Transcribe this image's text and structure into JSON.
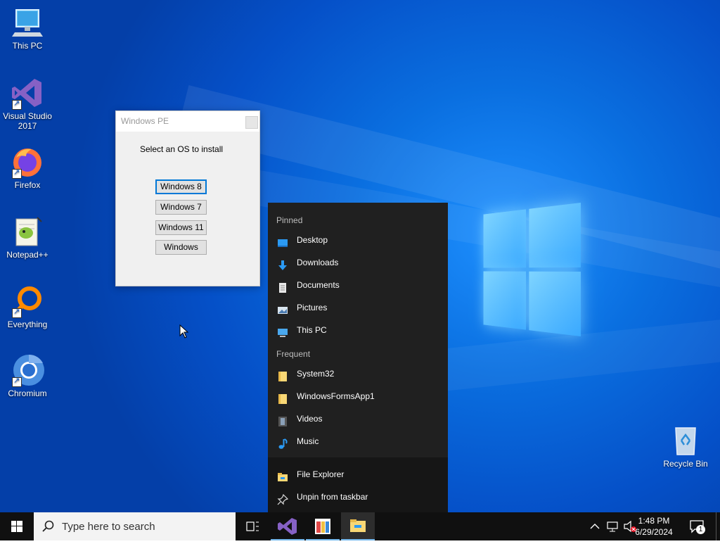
{
  "desktop": {
    "icons": [
      {
        "label": "This PC",
        "icon": "this-pc-icon"
      },
      {
        "label": "Visual Studio 2017",
        "icon": "visual-studio-icon"
      },
      {
        "label": "Firefox",
        "icon": "firefox-icon"
      },
      {
        "label": "Notepad++",
        "icon": "notepad-plus-plus-icon"
      },
      {
        "label": "Everything",
        "icon": "everything-search-icon"
      },
      {
        "label": "Chromium",
        "icon": "chromium-icon"
      },
      {
        "label": "Recycle Bin",
        "icon": "recycle-bin-icon"
      }
    ]
  },
  "pe_dialog": {
    "title": "Windows PE",
    "prompt": "Select an OS to install",
    "buttons": [
      "Windows 8",
      "Windows 7",
      "Windows 11",
      "Windows"
    ]
  },
  "jumplist": {
    "pinned_header": "Pinned",
    "pinned": [
      "Desktop",
      "Downloads",
      "Documents",
      "Pictures",
      "This PC"
    ],
    "frequent_header": "Frequent",
    "frequent": [
      "System32",
      "WindowsFormsApp1",
      "Videos",
      "Music"
    ],
    "actions": [
      "File Explorer",
      "Unpin from taskbar"
    ]
  },
  "taskbar": {
    "search_placeholder": "Type here to search",
    "time": "1:48 PM",
    "date": "6/29/2024",
    "notification_count": "1"
  },
  "colors": {
    "accent": "#0078d7",
    "taskbar": "#101010",
    "jumplist_bg": "#202020"
  }
}
